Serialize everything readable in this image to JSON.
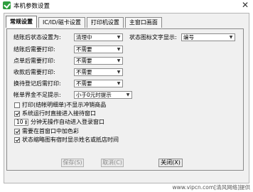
{
  "window": {
    "title": "本机参数设置",
    "close_glyph": "✕"
  },
  "tabs": [
    {
      "label": "常规设置",
      "active": true
    },
    {
      "label": "IC/ID/磁卡设置",
      "active": false
    },
    {
      "label": "打印机设置",
      "active": false
    },
    {
      "label": "主窗口画面",
      "active": false
    }
  ],
  "settings": {
    "checkout_status": {
      "label": "结账后状态设置为:",
      "value": "清理中"
    },
    "print_after_checkout": {
      "label": "结账后需要打印:",
      "value": "不需要"
    },
    "print_after_order": {
      "label": "点单后需要打印:",
      "value": "不需要"
    },
    "print_after_deposit": {
      "label": "收款后需要打印:",
      "value": "不需要"
    },
    "print_after_room_change": {
      "label": "换待登记后需打印:",
      "value": "不需要"
    },
    "prompt_under_amount": {
      "label": "帐单界金不足提示:",
      "value": "小于0元时提示"
    },
    "status_icon_text": {
      "label": "状态图标文字显示:",
      "value": "编号"
    }
  },
  "options": {
    "print_detail_blank": {
      "label": "打印(结帐明细单)不显示冲销商品",
      "checked": false
    },
    "enter_room_window": {
      "label": "系统运行时直接进入接待窗口",
      "checked": true
    },
    "idle_minutes": {
      "value": "10",
      "label": "分钟无操作自动进入登录窗口",
      "checked": true
    },
    "color_in_main_window": {
      "label": "需要在首窗口中加色彩",
      "checked": true
    },
    "show_customer_in_icon": {
      "label": "状态缩略图有宿时显示姓名或抵店时间",
      "checked": true
    }
  },
  "buttons": {
    "save": "保存(S)",
    "cancel": "取消(C)",
    "close": "关闭(X)"
  },
  "footer": {
    "text": "www.vipcn.com[清风网络]提供"
  }
}
